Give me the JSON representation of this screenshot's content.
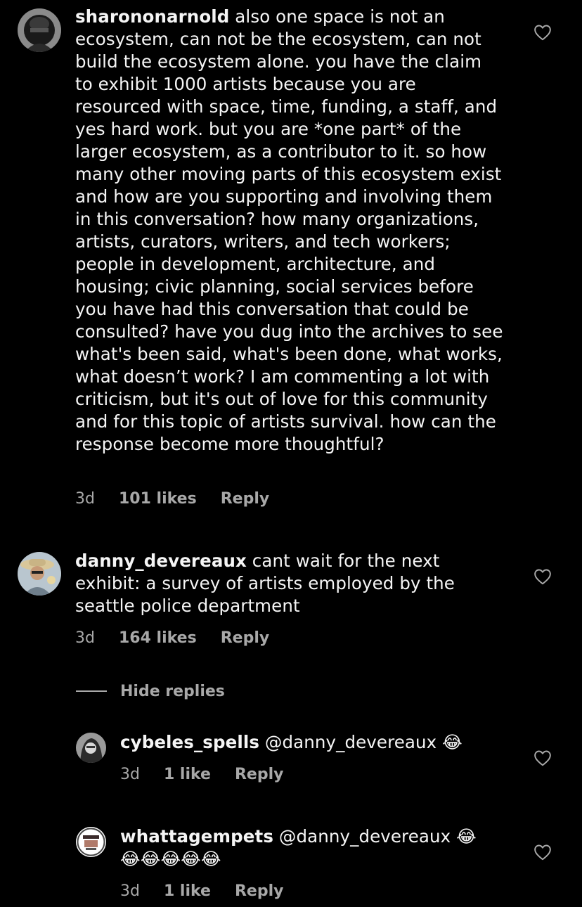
{
  "comments": [
    {
      "username": "sharononarnold",
      "text": " also one space is not an ecosystem, can not be the ecosystem, can not build the ecosystem alone. you have the claim to exhibit 1000 artists because you are resourced with space, time, funding, a staff, and yes hard work. but you are *one part* of the larger ecosystem, as a contributor to it. so how many other moving parts of this ecosystem exist and how are you supporting and involving them in this conversation? how many organizations, artists, curators, writers, and tech workers; people in development, architecture, and housing; civic planning, social services before you have had this conversation that could be consulted? have you dug into the archives to see what's been said, what's been done, what works, what doesn’t work? I am commenting a lot with criticism, but it's out of love for this community and for this topic of artists survival. how can the response become more thoughtful?",
      "time": "3d",
      "likes": "101 likes",
      "reply": "Reply"
    },
    {
      "username": "danny_devereaux",
      "text": " cant wait for the next exhibit: a survey of artists employed by the seattle police department",
      "time": "3d",
      "likes": "164 likes",
      "reply": "Reply"
    }
  ],
  "hide_replies": "Hide replies",
  "replies": [
    {
      "username": "cybeles_spells",
      "text": " @danny_devereaux 😂",
      "time": "3d",
      "likes": "1 like",
      "reply": "Reply"
    },
    {
      "username": "whattagempets",
      "text": " @danny_devereaux 😂 😂😂😂😂😂",
      "time": "3d",
      "likes": "1 like",
      "reply": "Reply"
    }
  ],
  "icons": {
    "like": "heart-outline-icon"
  },
  "colors": {
    "background": "#000000",
    "text": "#f5f5f5",
    "secondary": "#a8a8a8"
  }
}
